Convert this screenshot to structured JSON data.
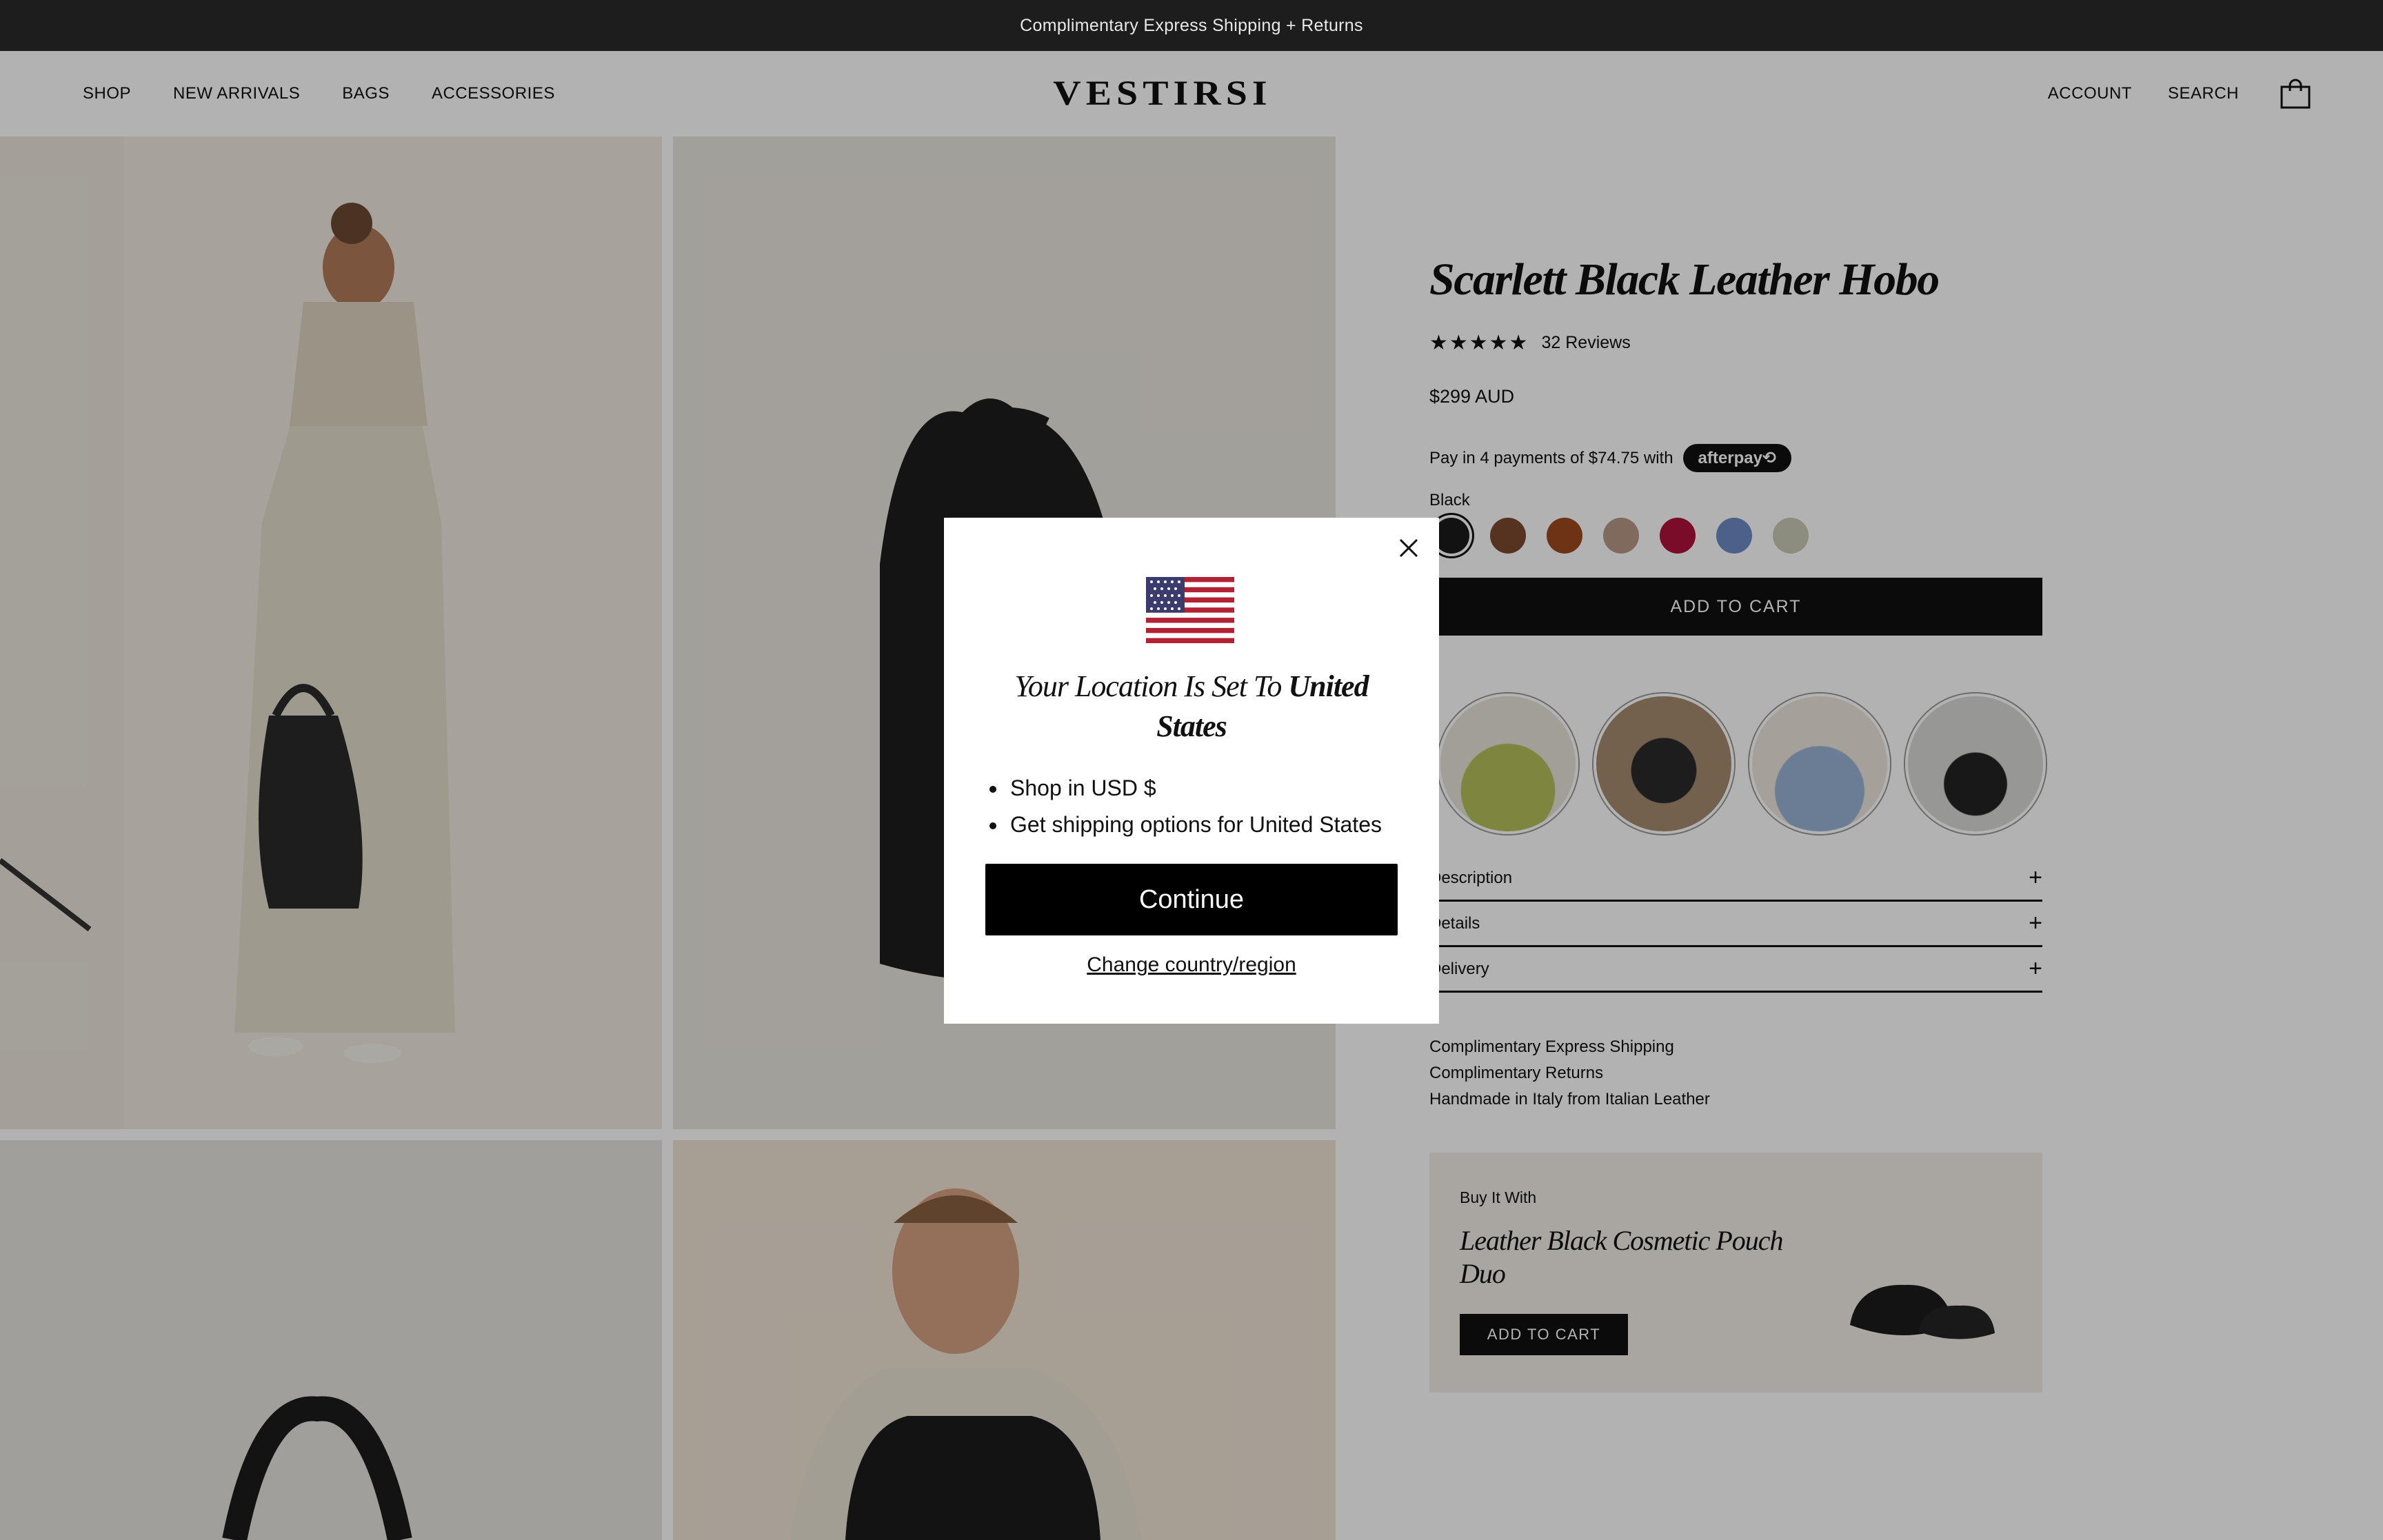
{
  "announcement": "Complimentary Express Shipping + Returns",
  "header": {
    "nav_left": [
      "SHOP",
      "NEW ARRIVALS",
      "BAGS",
      "ACCESSORIES"
    ],
    "logo": "VESTIRSI",
    "nav_right": [
      "ACCOUNT",
      "SEARCH"
    ],
    "cart_icon": "shopping-bag-icon"
  },
  "product": {
    "title": "Scarlett Black Leather Hobo",
    "stars": "★★★★★",
    "reviews": "32 Reviews",
    "price": "$299 AUD",
    "afterpay_text": "Pay in 4 payments of $74.75 with",
    "afterpay_badge": "afterpay⟲",
    "selected_color": "Black",
    "swatches": [
      "#1a1a1a",
      "#7a4a2e",
      "#9c4a1f",
      "#b89886",
      "#b0123a",
      "#6d8bc4",
      "#c9cab6"
    ],
    "add_to_cart": "ADD TO CART",
    "accordion": [
      "Description",
      "Details",
      "Delivery"
    ],
    "perks": [
      "Complimentary Express Shipping",
      "Complimentary Returns",
      "Handmade in Italy from Italian Leather"
    ]
  },
  "buy_with": {
    "label": "Buy It With",
    "title": "Leather Black Cosmetic Pouch Duo",
    "button": "ADD TO CART"
  },
  "modal": {
    "title_prefix": "Your Location Is Set To ",
    "title_country": "United States",
    "bullets": [
      "Shop in USD $",
      "Get shipping options for United States"
    ],
    "continue": "Continue",
    "change": "Change country/region",
    "flag_icon": "us-flag-icon",
    "close_icon": "close-icon"
  },
  "colors": {
    "announce_bg": "#1d1d1d",
    "button_bg": "#111111",
    "overlay": "rgba(0,0,0,0.3)"
  }
}
